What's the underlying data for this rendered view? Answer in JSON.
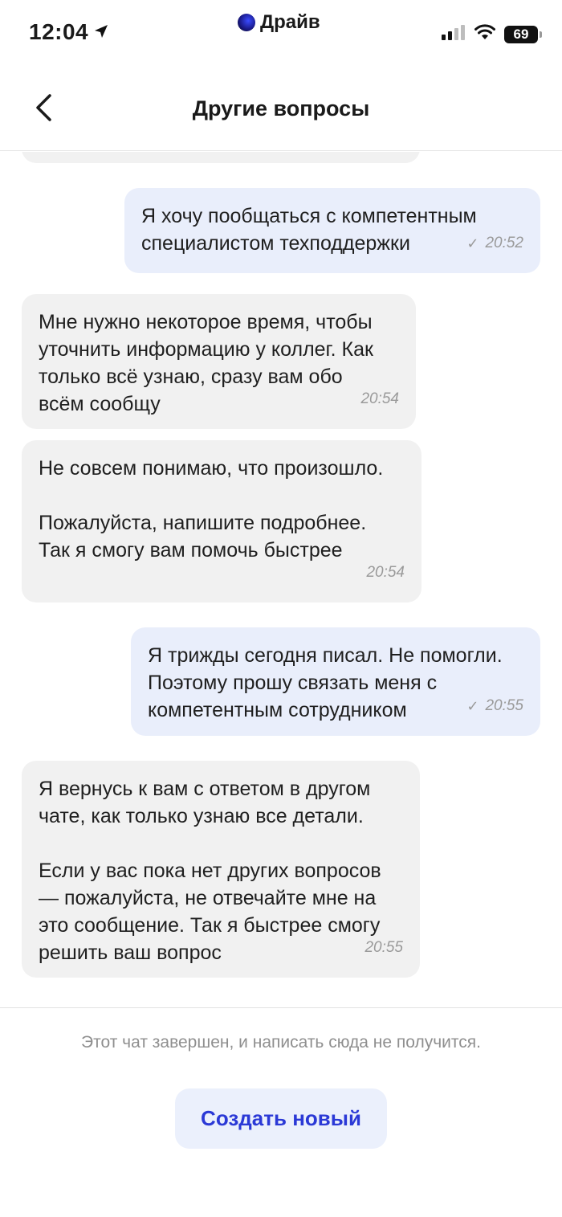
{
  "status": {
    "time": "12:04",
    "app_name": "Драйв",
    "battery": "69"
  },
  "header": {
    "title": "Другие вопросы"
  },
  "messages": [
    {
      "text": "Я хочу пообщаться с компетентным\nспециалистом техподдержки",
      "time": "20:52"
    },
    {
      "text": "Мне нужно некоторое время, чтобы\nуточнить информацию у коллег. Как\nтолько всё узнаю, сразу вам обо\nвсём сообщу",
      "time": "20:54"
    },
    {
      "text": "Не совсем понимаю, что произошло.\n\nПожалуйста, напишите подробнее.\nТак я смогу вам помочь быстрее",
      "time": "20:54"
    },
    {
      "text": "Я трижды сегодня писал. Не помогли.\nПоэтому прошу связать меня с\nкомпетентным сотрудником",
      "time": "20:55"
    },
    {
      "text": "Я вернусь к вам с ответом в другом\nчате, как только узнаю все детали.\n\nЕсли у вас пока нет других вопросов\n— пожалуйста, не отвечайте мне на\nэто сообщение. Так я быстрее смогу\nрешить ваш вопрос",
      "time": "20:55"
    }
  ],
  "footer": {
    "ended_note": "Этот чат завершен, и написать сюда не получится.",
    "create_button": "Создать новый"
  }
}
